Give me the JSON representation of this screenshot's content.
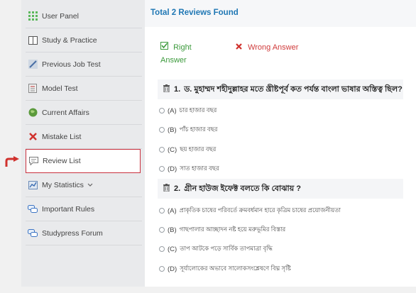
{
  "sidebar": {
    "items": [
      {
        "label": "User Panel",
        "icon": "grid-icon"
      },
      {
        "label": "Study & Practice",
        "icon": "book-icon"
      },
      {
        "label": "Previous Job Test",
        "icon": "pencil-icon"
      },
      {
        "label": "Model Test",
        "icon": "document-icon"
      },
      {
        "label": "Current Affairs",
        "icon": "globe-icon"
      },
      {
        "label": "Mistake List",
        "icon": "x-icon"
      },
      {
        "label": "Review List",
        "icon": "comment-icon"
      },
      {
        "label": "My Statistics",
        "icon": "chart-icon"
      },
      {
        "label": "Important Rules",
        "icon": "chat-icon"
      },
      {
        "label": "Studypress Forum",
        "icon": "chat-icon"
      }
    ],
    "active_index": 6,
    "accent_color": "#c9303e"
  },
  "main": {
    "title": "Total 2 Reviews Found",
    "legend": {
      "right": "Right Answer",
      "wrong": "Wrong Answer"
    },
    "questions": [
      {
        "number": "1.",
        "text": "ড. মুহাম্মদ শহীদুল্লাহর মতে খ্রীষ্টপূর্ব কত পর্যন্ত বাংলা ভাষার অস্তিত্ব ছিল?",
        "options": [
          {
            "label": "(A)",
            "text": "চার হাজার বছর"
          },
          {
            "label": "(B)",
            "text": "পাঁচ হাজার বছর"
          },
          {
            "label": "(C)",
            "text": "ছয় হাজার বছর"
          },
          {
            "label": "(D)",
            "text": "সাত হাজার বছর"
          }
        ]
      },
      {
        "number": "2.",
        "text": "গ্রীন হাউজ ইফেক্ট বলতে কি বোঝায় ?",
        "options": [
          {
            "label": "(A)",
            "text": "প্রাকৃতিক চাষের পরিবর্তে ক্রমবর্ধমান হারে কৃত্রিম চাষের প্রয়োজনীয়তা"
          },
          {
            "label": "(B)",
            "text": "গাছপালার আচ্ছাদন নষ্ট হয়ে মরুভূমির বিস্তার"
          },
          {
            "label": "(C)",
            "text": "তাপ আটকে পড়ে সার্বিক তাপমাত্রা বৃদ্ধি"
          },
          {
            "label": "(D)",
            "text": "সূর্যালোকের অভাবে সালোকসংশ্লেষণে বিঘ্ন সৃষ্টি"
          }
        ]
      }
    ]
  }
}
